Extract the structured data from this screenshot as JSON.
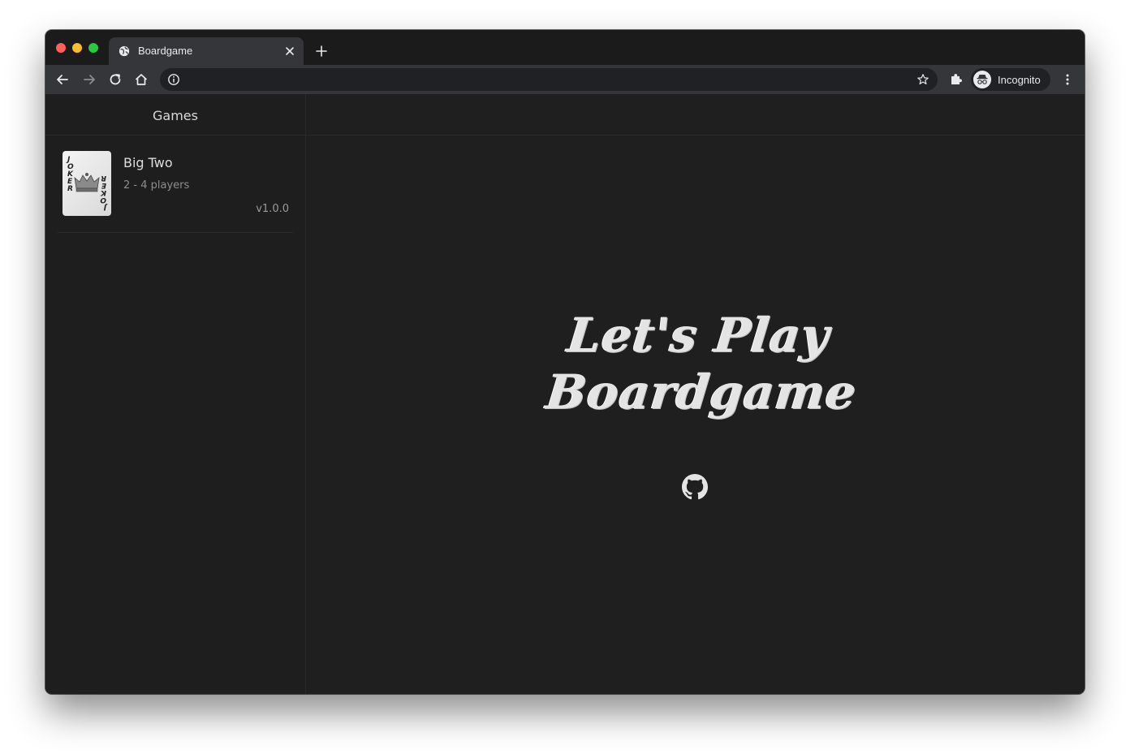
{
  "browser": {
    "tab": {
      "title": "Boardgame"
    },
    "profile": {
      "label": "Incognito"
    },
    "icons": {
      "favicon": "globe-icon",
      "close": "close-icon",
      "new_tab": "plus-icon",
      "back": "arrow-left-icon",
      "forward": "arrow-right-icon",
      "reload": "reload-icon",
      "home": "home-icon",
      "info": "info-icon",
      "bookmark": "star-icon",
      "extensions": "puzzle-icon",
      "avatar": "incognito-icon",
      "menu": "kebab-menu-icon"
    },
    "colors": {
      "traffic_red": "#fe5f57",
      "traffic_yellow": "#febc2e",
      "traffic_green": "#28c840"
    }
  },
  "sidebar": {
    "title": "Games",
    "games": [
      {
        "name": "Big Two",
        "players": "2 - 4 players",
        "version": "v1.0.0",
        "thumbnail": "joker-card-icon"
      }
    ]
  },
  "main": {
    "hero": {
      "line1": "Let's Play",
      "line2": "Boardgame"
    },
    "github_icon": "github-icon"
  }
}
